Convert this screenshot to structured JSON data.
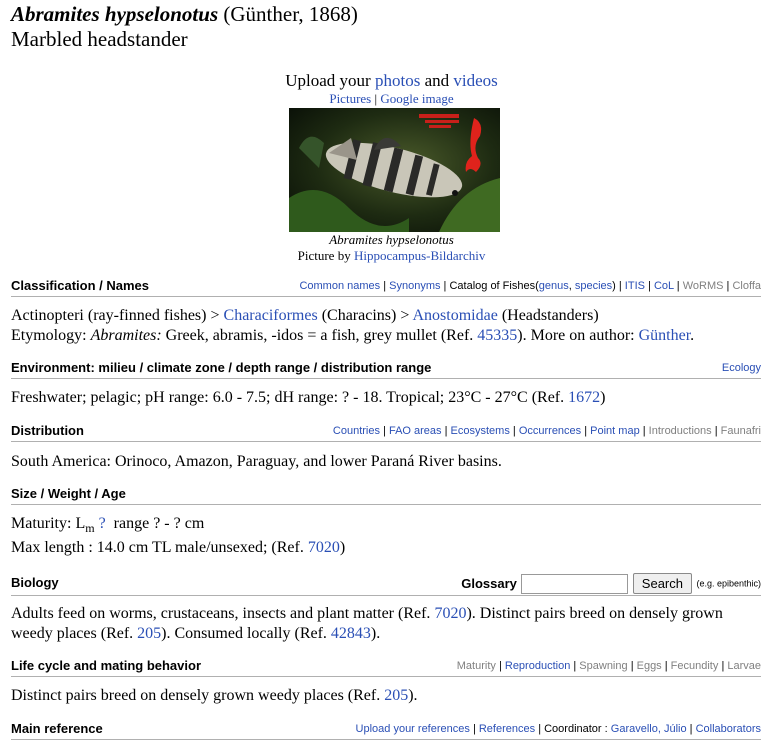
{
  "species": {
    "genus_species": "Abramites hypselonotus",
    "author": "(Günther, 1868)",
    "common_name": "Marbled headstander"
  },
  "media": {
    "upload_prefix": "Upload your",
    "photos": "photos",
    "and": "and",
    "videos": "videos",
    "pictures": "Pictures",
    "google_image": "Google image",
    "caption": "Abramites hypselonotus",
    "credit_prefix": "Picture by",
    "credit_name": "Hippocampus-Bildarchiv"
  },
  "classification": {
    "heading": "Classification / Names",
    "links": {
      "common_names": "Common names",
      "synonyms": "Synonyms",
      "catalog_prefix": "Catalog of Fishes(",
      "genus": "genus",
      "species": "species",
      "catalog_suffix": ")",
      "itis": "ITIS",
      "col": "CoL",
      "worms": "WoRMS",
      "cloffa": "Cloffa"
    },
    "line1": {
      "class": "Actinopteri (ray-finned fishes)",
      "order": "Characiformes",
      "order_common": "(Characins)",
      "family": "Anostomidae",
      "family_common": "(Headstanders)"
    },
    "etymology": {
      "label": "Etymology:",
      "genus": "Abramites:",
      "text": "Greek, abramis, -idos = a fish, grey mullet (Ref.",
      "ref": "45335",
      "more": "). More on author:",
      "author": "Günther",
      "end": "."
    }
  },
  "environment": {
    "heading": "Environment: milieu / climate zone / depth range / distribution range",
    "link": "Ecology",
    "text": "Freshwater; pelagic; pH range: 6.0 - 7.5; dH range: ? - 18.   Tropical; 23°C - 27°C (Ref.",
    "ref": "1672",
    "end": ")"
  },
  "distribution": {
    "heading": "Distribution",
    "links": {
      "countries": "Countries",
      "fao": "FAO areas",
      "ecosystems": "Ecosystems",
      "occurrences": "Occurrences",
      "point_map": "Point map",
      "introductions": "Introductions",
      "faunafri": "Faunafri"
    },
    "text": "South America: Orinoco, Amazon, Paraguay, and lower Paraná River basins."
  },
  "size": {
    "heading": "Size / Weight / Age",
    "maturity_label": "Maturity: L",
    "maturity_sub": "m",
    "maturity_q": "?",
    "maturity_range": "range ? - ? cm",
    "max_length": "Max length : 14.0 cm TL male/unsexed; (Ref.",
    "ref": "7020",
    "end": ")"
  },
  "biology": {
    "heading": "Biology",
    "glossary_label": "Glossary",
    "glossary_value": "",
    "search_button": "Search",
    "example": "(e.g. epibenthic)",
    "t1": "Adults feed on worms, crustaceans, insects and plant matter (Ref.",
    "r1": "7020",
    "t2": "). Distinct pairs breed on densely grown weedy places (Ref.",
    "r2": "205",
    "t3": "). Consumed locally (Ref.",
    "r3": "42843",
    "t4": ")."
  },
  "lifecycle": {
    "heading": "Life cycle and mating behavior",
    "links": {
      "maturity": "Maturity",
      "reproduction": "Reproduction",
      "spawning": "Spawning",
      "eggs": "Eggs",
      "fecundity": "Fecundity",
      "larvae": "Larvae"
    },
    "text": "Distinct pairs breed on densely grown weedy places (Ref.",
    "ref": "205",
    "end": ")."
  },
  "main_reference": {
    "heading": "Main reference",
    "upload": "Upload your references",
    "references": "References",
    "coordinator_label": "Coordinator :",
    "coordinator": "Garavello, Júlio",
    "collaborators": "Collaborators"
  }
}
